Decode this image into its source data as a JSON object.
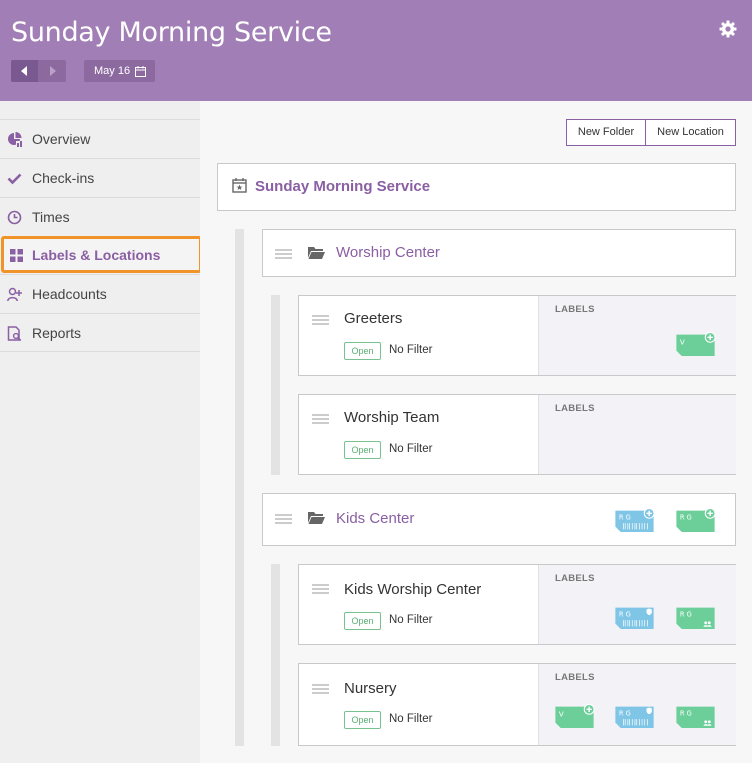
{
  "header": {
    "title": "Sunday Morning Service",
    "date_label": "May 16"
  },
  "sidebar": {
    "items": [
      {
        "label": "Overview",
        "icon": "overview-icon"
      },
      {
        "label": "Check-ins",
        "icon": "checkmark-icon"
      },
      {
        "label": "Times",
        "icon": "clock-icon"
      },
      {
        "label": "Labels & Locations",
        "icon": "grid-icon",
        "active": true
      },
      {
        "label": "Headcounts",
        "icon": "person-add-icon"
      },
      {
        "label": "Reports",
        "icon": "report-icon"
      }
    ]
  },
  "toolbar": {
    "new_folder": "New Folder",
    "new_location": "New Location"
  },
  "service": {
    "title": "Sunday Morning Service"
  },
  "folders": [
    {
      "name": "Worship Center",
      "locations": [
        {
          "name": "Greeters",
          "status": "Open",
          "filter": "No Filter",
          "labels_header": "LABELS",
          "labels": [
            "V-add"
          ]
        },
        {
          "name": "Worship Team",
          "status": "Open",
          "filter": "No Filter",
          "labels_header": "LABELS",
          "labels": []
        }
      ]
    },
    {
      "name": "Kids Center",
      "folder_labels": [
        "RG-barcode-add",
        "RG-add"
      ],
      "locations": [
        {
          "name": "Kids Worship Center",
          "status": "Open",
          "filter": "No Filter",
          "labels_header": "LABELS",
          "labels": [
            "RG-barcode-shield",
            "RG-people"
          ]
        },
        {
          "name": "Nursery",
          "status": "Open",
          "filter": "No Filter",
          "labels_header": "LABELS",
          "labels": [
            "V-add",
            "RG-barcode-shield",
            "RG-people"
          ]
        }
      ]
    }
  ],
  "tag_text": {
    "v": "V",
    "rg": "R G"
  },
  "colors": {
    "header": "#a17fb6",
    "accent": "#8a5fa3",
    "active_outline": "#f0942a",
    "label_green": "#6ccf9a",
    "label_blue": "#7fc5e6"
  }
}
